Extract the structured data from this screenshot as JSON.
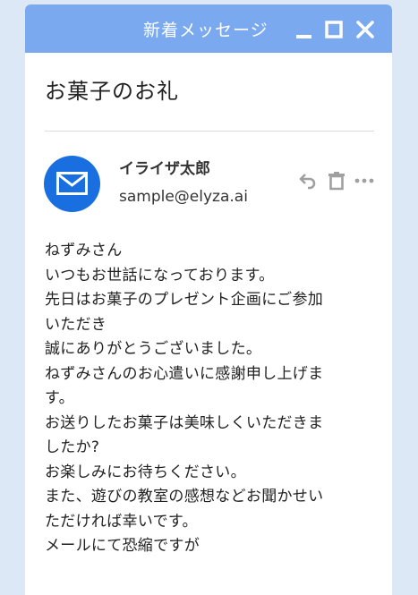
{
  "window": {
    "title": "新着メッセージ",
    "controls": [
      "minimize-icon",
      "maximize-icon",
      "close-icon"
    ],
    "accent_color": "#7aa9f0"
  },
  "message": {
    "subject": "お菓子のお礼",
    "sender": {
      "name": "イライザ太郎",
      "email": "sample@elyza.ai",
      "avatar_icon": "mail-icon",
      "avatar_color": "#1a6fe0"
    },
    "actions": [
      "reply-icon",
      "delete-icon",
      "more-icon"
    ],
    "body_lines": [
      "ねずみさん",
      "いつもお世話になっております。",
      "先日はお菓子のプレゼント企画にご参加",
      "いただき",
      "誠にありがとうございました。",
      "ねずみさんのお心遣いに感謝申し上げま",
      "す。",
      "お送りしたお菓子は美味しくいただきま",
      "したか?",
      "お楽しみにお待ちください。",
      "また、遊びの教室の感想などお聞かせい",
      "ただければ幸いです。",
      "メールにて恐縮ですが"
    ]
  }
}
